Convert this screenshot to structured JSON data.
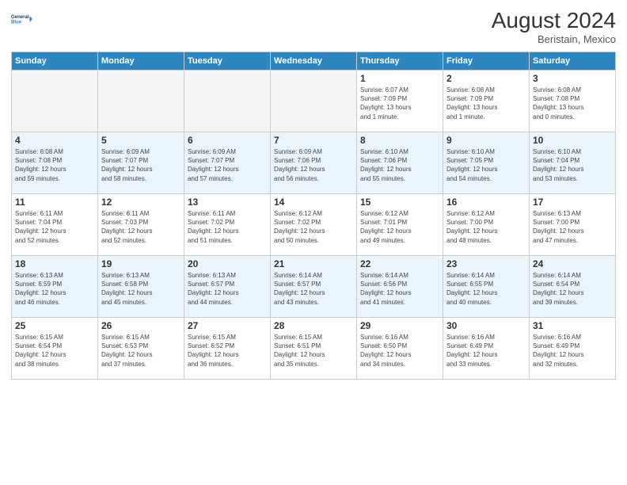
{
  "header": {
    "logo_line1": "General",
    "logo_line2": "Blue",
    "month_title": "August 2024",
    "subtitle": "Beristain, Mexico"
  },
  "days_of_week": [
    "Sunday",
    "Monday",
    "Tuesday",
    "Wednesday",
    "Thursday",
    "Friday",
    "Saturday"
  ],
  "weeks": [
    [
      {
        "day": "",
        "info": ""
      },
      {
        "day": "",
        "info": ""
      },
      {
        "day": "",
        "info": ""
      },
      {
        "day": "",
        "info": ""
      },
      {
        "day": "1",
        "info": "Sunrise: 6:07 AM\nSunset: 7:09 PM\nDaylight: 13 hours\nand 1 minute."
      },
      {
        "day": "2",
        "info": "Sunrise: 6:08 AM\nSunset: 7:09 PM\nDaylight: 13 hours\nand 1 minute."
      },
      {
        "day": "3",
        "info": "Sunrise: 6:08 AM\nSunset: 7:08 PM\nDaylight: 13 hours\nand 0 minutes."
      }
    ],
    [
      {
        "day": "4",
        "info": "Sunrise: 6:08 AM\nSunset: 7:08 PM\nDaylight: 12 hours\nand 59 minutes."
      },
      {
        "day": "5",
        "info": "Sunrise: 6:09 AM\nSunset: 7:07 PM\nDaylight: 12 hours\nand 58 minutes."
      },
      {
        "day": "6",
        "info": "Sunrise: 6:09 AM\nSunset: 7:07 PM\nDaylight: 12 hours\nand 57 minutes."
      },
      {
        "day": "7",
        "info": "Sunrise: 6:09 AM\nSunset: 7:06 PM\nDaylight: 12 hours\nand 56 minutes."
      },
      {
        "day": "8",
        "info": "Sunrise: 6:10 AM\nSunset: 7:06 PM\nDaylight: 12 hours\nand 55 minutes."
      },
      {
        "day": "9",
        "info": "Sunrise: 6:10 AM\nSunset: 7:05 PM\nDaylight: 12 hours\nand 54 minutes."
      },
      {
        "day": "10",
        "info": "Sunrise: 6:10 AM\nSunset: 7:04 PM\nDaylight: 12 hours\nand 53 minutes."
      }
    ],
    [
      {
        "day": "11",
        "info": "Sunrise: 6:11 AM\nSunset: 7:04 PM\nDaylight: 12 hours\nand 52 minutes."
      },
      {
        "day": "12",
        "info": "Sunrise: 6:11 AM\nSunset: 7:03 PM\nDaylight: 12 hours\nand 52 minutes."
      },
      {
        "day": "13",
        "info": "Sunrise: 6:11 AM\nSunset: 7:02 PM\nDaylight: 12 hours\nand 51 minutes."
      },
      {
        "day": "14",
        "info": "Sunrise: 6:12 AM\nSunset: 7:02 PM\nDaylight: 12 hours\nand 50 minutes."
      },
      {
        "day": "15",
        "info": "Sunrise: 6:12 AM\nSunset: 7:01 PM\nDaylight: 12 hours\nand 49 minutes."
      },
      {
        "day": "16",
        "info": "Sunrise: 6:12 AM\nSunset: 7:00 PM\nDaylight: 12 hours\nand 48 minutes."
      },
      {
        "day": "17",
        "info": "Sunrise: 6:13 AM\nSunset: 7:00 PM\nDaylight: 12 hours\nand 47 minutes."
      }
    ],
    [
      {
        "day": "18",
        "info": "Sunrise: 6:13 AM\nSunset: 6:59 PM\nDaylight: 12 hours\nand 46 minutes."
      },
      {
        "day": "19",
        "info": "Sunrise: 6:13 AM\nSunset: 6:58 PM\nDaylight: 12 hours\nand 45 minutes."
      },
      {
        "day": "20",
        "info": "Sunrise: 6:13 AM\nSunset: 6:57 PM\nDaylight: 12 hours\nand 44 minutes."
      },
      {
        "day": "21",
        "info": "Sunrise: 6:14 AM\nSunset: 6:57 PM\nDaylight: 12 hours\nand 43 minutes."
      },
      {
        "day": "22",
        "info": "Sunrise: 6:14 AM\nSunset: 6:56 PM\nDaylight: 12 hours\nand 41 minutes."
      },
      {
        "day": "23",
        "info": "Sunrise: 6:14 AM\nSunset: 6:55 PM\nDaylight: 12 hours\nand 40 minutes."
      },
      {
        "day": "24",
        "info": "Sunrise: 6:14 AM\nSunset: 6:54 PM\nDaylight: 12 hours\nand 39 minutes."
      }
    ],
    [
      {
        "day": "25",
        "info": "Sunrise: 6:15 AM\nSunset: 6:54 PM\nDaylight: 12 hours\nand 38 minutes."
      },
      {
        "day": "26",
        "info": "Sunrise: 6:15 AM\nSunset: 6:53 PM\nDaylight: 12 hours\nand 37 minutes."
      },
      {
        "day": "27",
        "info": "Sunrise: 6:15 AM\nSunset: 6:52 PM\nDaylight: 12 hours\nand 36 minutes."
      },
      {
        "day": "28",
        "info": "Sunrise: 6:15 AM\nSunset: 6:51 PM\nDaylight: 12 hours\nand 35 minutes."
      },
      {
        "day": "29",
        "info": "Sunrise: 6:16 AM\nSunset: 6:50 PM\nDaylight: 12 hours\nand 34 minutes."
      },
      {
        "day": "30",
        "info": "Sunrise: 6:16 AM\nSunset: 6:49 PM\nDaylight: 12 hours\nand 33 minutes."
      },
      {
        "day": "31",
        "info": "Sunrise: 6:16 AM\nSunset: 6:49 PM\nDaylight: 12 hours\nand 32 minutes."
      }
    ]
  ]
}
